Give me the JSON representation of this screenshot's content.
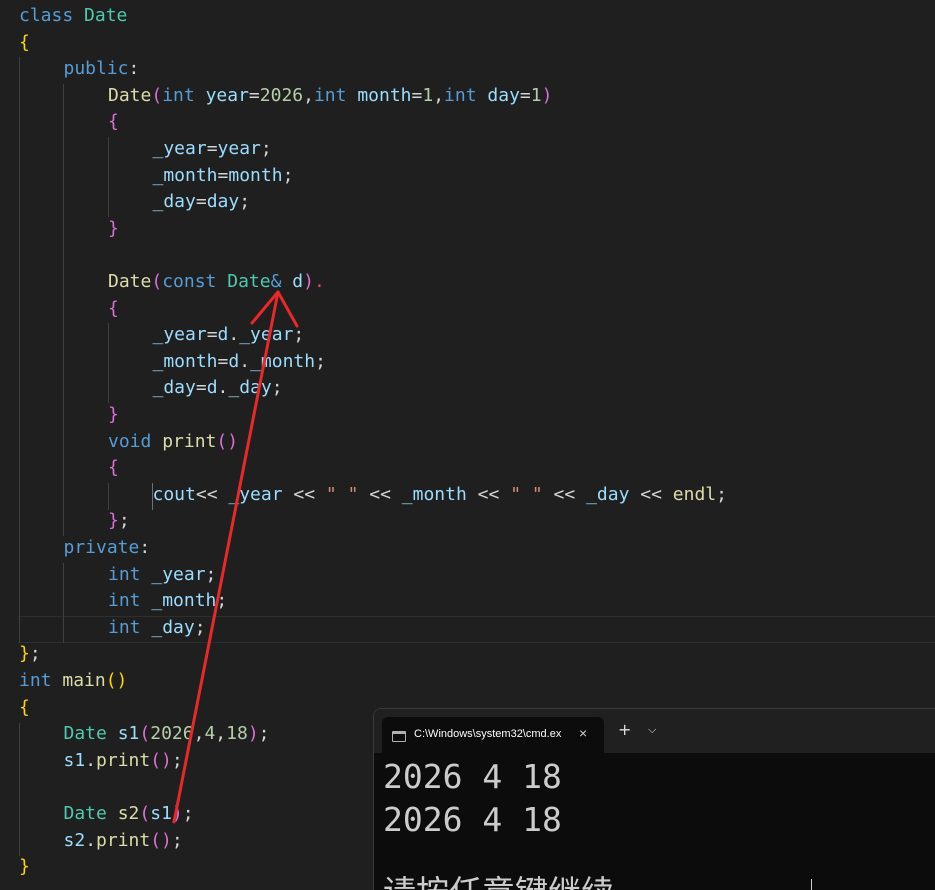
{
  "editor": {
    "language": "cpp",
    "lines": [
      {
        "n": 1,
        "indent": 0,
        "tokens": [
          [
            "kw",
            "class"
          ],
          [
            "op",
            " "
          ],
          [
            "cls",
            "Date"
          ]
        ]
      },
      {
        "n": 2,
        "indent": 0,
        "tokens": [
          [
            "b1",
            "{"
          ]
        ]
      },
      {
        "n": 3,
        "indent": 1,
        "tokens": [
          [
            "kw",
            "public"
          ],
          [
            "op",
            ":"
          ]
        ]
      },
      {
        "n": 4,
        "indent": 2,
        "tokens": [
          [
            "fn",
            "Date"
          ],
          [
            "b2",
            "("
          ],
          [
            "kw",
            "int"
          ],
          [
            "op",
            " "
          ],
          [
            "var",
            "year"
          ],
          [
            "op",
            "="
          ],
          [
            "num",
            "2026"
          ],
          [
            "op",
            ","
          ],
          [
            "kw",
            "int"
          ],
          [
            "op",
            " "
          ],
          [
            "var",
            "month"
          ],
          [
            "op",
            "="
          ],
          [
            "num",
            "1"
          ],
          [
            "op",
            ","
          ],
          [
            "kw",
            "int"
          ],
          [
            "op",
            " "
          ],
          [
            "var",
            "day"
          ],
          [
            "op",
            "="
          ],
          [
            "num",
            "1"
          ],
          [
            "b2",
            ")"
          ]
        ]
      },
      {
        "n": 5,
        "indent": 2,
        "tokens": [
          [
            "b2",
            "{"
          ]
        ]
      },
      {
        "n": 6,
        "indent": 3,
        "tokens": [
          [
            "var",
            "_year"
          ],
          [
            "op",
            "="
          ],
          [
            "var",
            "year"
          ],
          [
            "op",
            ";"
          ]
        ]
      },
      {
        "n": 7,
        "indent": 3,
        "tokens": [
          [
            "var",
            "_month"
          ],
          [
            "op",
            "="
          ],
          [
            "var",
            "month"
          ],
          [
            "op",
            ";"
          ]
        ]
      },
      {
        "n": 8,
        "indent": 3,
        "tokens": [
          [
            "var",
            "_day"
          ],
          [
            "op",
            "="
          ],
          [
            "var",
            "day"
          ],
          [
            "op",
            ";"
          ]
        ]
      },
      {
        "n": 9,
        "indent": 2,
        "tokens": [
          [
            "b2",
            "}"
          ]
        ]
      },
      {
        "n": 10,
        "indent": 0,
        "tokens": []
      },
      {
        "n": 11,
        "indent": 2,
        "tokens": [
          [
            "fn",
            "Date"
          ],
          [
            "b2",
            "("
          ],
          [
            "kw",
            "const"
          ],
          [
            "op",
            " "
          ],
          [
            "cls",
            "Date"
          ],
          [
            "kw",
            "&"
          ],
          [
            "op",
            " "
          ],
          [
            "var",
            "d"
          ],
          [
            "b2",
            ")"
          ],
          [
            "red",
            "."
          ]
        ]
      },
      {
        "n": 12,
        "indent": 2,
        "tokens": [
          [
            "b2",
            "{"
          ]
        ]
      },
      {
        "n": 13,
        "indent": 3,
        "tokens": [
          [
            "var",
            "_year"
          ],
          [
            "op",
            "="
          ],
          [
            "var",
            "d"
          ],
          [
            "op",
            "."
          ],
          [
            "var",
            "_year"
          ],
          [
            "op",
            ";"
          ]
        ]
      },
      {
        "n": 14,
        "indent": 3,
        "tokens": [
          [
            "var",
            "_month"
          ],
          [
            "op",
            "="
          ],
          [
            "var",
            "d"
          ],
          [
            "op",
            "."
          ],
          [
            "var",
            "_month"
          ],
          [
            "op",
            ";"
          ]
        ]
      },
      {
        "n": 15,
        "indent": 3,
        "tokens": [
          [
            "var",
            "_day"
          ],
          [
            "op",
            "="
          ],
          [
            "var",
            "d"
          ],
          [
            "op",
            "."
          ],
          [
            "var",
            "_day"
          ],
          [
            "op",
            ";"
          ]
        ]
      },
      {
        "n": 16,
        "indent": 2,
        "tokens": [
          [
            "b2",
            "}"
          ]
        ]
      },
      {
        "n": 17,
        "indent": 2,
        "tokens": [
          [
            "kw",
            "void"
          ],
          [
            "op",
            " "
          ],
          [
            "fn",
            "print"
          ],
          [
            "b2",
            "()"
          ]
        ]
      },
      {
        "n": 18,
        "indent": 2,
        "tokens": [
          [
            "b2",
            "{"
          ]
        ]
      },
      {
        "n": 19,
        "indent": 3,
        "tokens": [
          [
            "var",
            "cout"
          ],
          [
            "op",
            "<< "
          ],
          [
            "var",
            "_year"
          ],
          [
            "op",
            " << "
          ],
          [
            "str",
            "\" \""
          ],
          [
            "op",
            " << "
          ],
          [
            "var",
            "_month"
          ],
          [
            "op",
            " << "
          ],
          [
            "str",
            "\" \""
          ],
          [
            "op",
            " << "
          ],
          [
            "var",
            "_day"
          ],
          [
            "op",
            " << "
          ],
          [
            "fn",
            "endl"
          ],
          [
            "op",
            ";"
          ]
        ]
      },
      {
        "n": 20,
        "indent": 2,
        "tokens": [
          [
            "b2",
            "}"
          ],
          [
            "op",
            ";"
          ]
        ]
      },
      {
        "n": 21,
        "indent": 1,
        "tokens": [
          [
            "kw",
            "private"
          ],
          [
            "op",
            ":"
          ]
        ]
      },
      {
        "n": 22,
        "indent": 2,
        "tokens": [
          [
            "kw",
            "int"
          ],
          [
            "op",
            " "
          ],
          [
            "var",
            "_year"
          ],
          [
            "op",
            ";"
          ]
        ]
      },
      {
        "n": 23,
        "indent": 2,
        "tokens": [
          [
            "kw",
            "int"
          ],
          [
            "op",
            " "
          ],
          [
            "var",
            "_month"
          ],
          [
            "op",
            ";"
          ]
        ]
      },
      {
        "n": 24,
        "indent": 2,
        "tokens": [
          [
            "kw",
            "int"
          ],
          [
            "op",
            " "
          ],
          [
            "var",
            "_day"
          ],
          [
            "op",
            ";"
          ]
        ]
      },
      {
        "n": 25,
        "indent": 0,
        "tokens": [
          [
            "b1",
            "}"
          ],
          [
            "op",
            ";"
          ]
        ]
      },
      {
        "n": 26,
        "indent": 0,
        "tokens": [
          [
            "kw",
            "int"
          ],
          [
            "op",
            " "
          ],
          [
            "fn",
            "main"
          ],
          [
            "b1",
            "()"
          ]
        ]
      },
      {
        "n": 27,
        "indent": 0,
        "tokens": [
          [
            "b1",
            "{"
          ]
        ]
      },
      {
        "n": 28,
        "indent": 1,
        "tokens": [
          [
            "cls",
            "Date"
          ],
          [
            "op",
            " "
          ],
          [
            "var",
            "s1"
          ],
          [
            "b2",
            "("
          ],
          [
            "num",
            "2026"
          ],
          [
            "op",
            ","
          ],
          [
            "num",
            "4"
          ],
          [
            "op",
            ","
          ],
          [
            "num",
            "18"
          ],
          [
            "b2",
            ")"
          ],
          [
            "op",
            ";"
          ]
        ]
      },
      {
        "n": 29,
        "indent": 1,
        "tokens": [
          [
            "var",
            "s1"
          ],
          [
            "op",
            "."
          ],
          [
            "fn",
            "print"
          ],
          [
            "b2",
            "()"
          ],
          [
            "op",
            ";"
          ]
        ]
      },
      {
        "n": 30,
        "indent": 0,
        "tokens": []
      },
      {
        "n": 31,
        "indent": 1,
        "tokens": [
          [
            "cls",
            "Date"
          ],
          [
            "op",
            " "
          ],
          [
            "fn",
            "s2"
          ],
          [
            "b2",
            "("
          ],
          [
            "var",
            "s1"
          ],
          [
            "b2",
            ")"
          ],
          [
            "op",
            ";"
          ]
        ]
      },
      {
        "n": 32,
        "indent": 1,
        "tokens": [
          [
            "var",
            "s2"
          ],
          [
            "op",
            "."
          ],
          [
            "fn",
            "print"
          ],
          [
            "b2",
            "()"
          ],
          [
            "op",
            ";"
          ]
        ]
      },
      {
        "n": 33,
        "indent": 0,
        "tokens": [
          [
            "b1",
            "}"
          ]
        ]
      }
    ],
    "annotation": {
      "color": "#e8282b",
      "description": "hand-drawn red arrow"
    }
  },
  "terminal": {
    "tab_title": "C:\\Windows\\system32\\cmd.ex",
    "close_glyph": "×",
    "new_tab_glyph": "+",
    "dropdown_glyph": "⌵",
    "output_lines": [
      "2026 4 18",
      "2026 4 18"
    ],
    "partial_line": "请按任意键继续. . ."
  },
  "colors": {
    "editor_bg": "#1f1f1f",
    "terminal_bg": "#0c0c0c",
    "arrow": "#e8282b"
  }
}
